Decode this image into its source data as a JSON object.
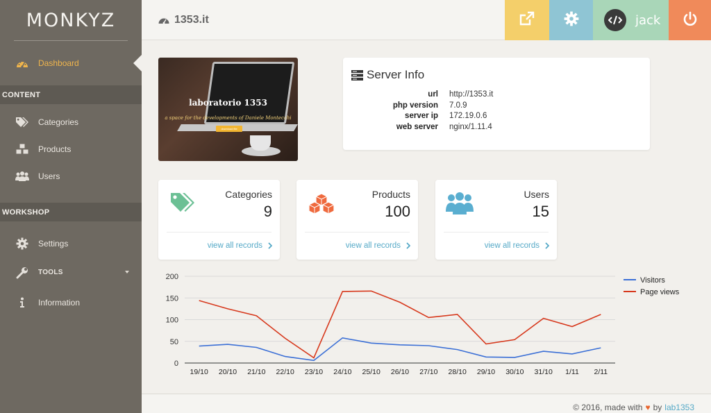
{
  "sidebar": {
    "logo": "MONKYZ",
    "items": {
      "dashboard": "Dashboard",
      "categories": "Categories",
      "products": "Products",
      "users": "Users",
      "settings": "Settings",
      "tools": "TOOLS",
      "information": "Information"
    },
    "sections": {
      "content": "CONTENT",
      "workshop": "WORKSHOP"
    }
  },
  "header": {
    "site": "1353.it",
    "user": "jack",
    "colors": {
      "external": "#f4cf6a",
      "settings": "#8fc5d4",
      "user": "#a9d6b8",
      "power": "#f08a5a"
    }
  },
  "hero": {
    "title": "laboratorio 1353",
    "subtitle": "a space for the developments of Daniele Montecchi",
    "button": "download file"
  },
  "server": {
    "title": "Server Info",
    "rows": [
      {
        "key": "url",
        "value": "http://1353.it"
      },
      {
        "key": "php version",
        "value": "7.0.9"
      },
      {
        "key": "server ip",
        "value": "172.19.0.6"
      },
      {
        "key": "web server",
        "value": "nginx/1.11.4"
      }
    ]
  },
  "stats": [
    {
      "label": "Categories",
      "value": "9",
      "link": "view all records",
      "icon": "tags-icon",
      "color": "#6cc095"
    },
    {
      "label": "Products",
      "value": "100",
      "link": "view all records",
      "icon": "cubes-icon",
      "color": "#ef6a3e"
    },
    {
      "label": "Users",
      "value": "15",
      "link": "view all records",
      "icon": "users-icon",
      "color": "#5aaed0"
    }
  ],
  "chart_data": {
    "type": "line",
    "categories": [
      "19/10",
      "20/10",
      "21/10",
      "22/10",
      "23/10",
      "24/10",
      "25/10",
      "26/10",
      "27/10",
      "28/10",
      "29/10",
      "30/10",
      "31/10",
      "1/11",
      "2/11"
    ],
    "series": [
      {
        "name": "Visitors",
        "color": "#3b6fd6",
        "values": [
          39,
          43,
          36,
          15,
          6,
          58,
          46,
          42,
          40,
          31,
          14,
          13,
          27,
          21,
          35
        ]
      },
      {
        "name": "Page views",
        "color": "#d7381c",
        "values": [
          144,
          125,
          109,
          57,
          12,
          165,
          166,
          140,
          105,
          112,
          44,
          54,
          103,
          84,
          112
        ]
      }
    ],
    "yticks": [
      0,
      50,
      100,
      150,
      200
    ],
    "ylim": [
      0,
      200
    ],
    "grid": true,
    "legend": "top-right"
  },
  "footer": {
    "text": "© 2016, made with",
    "by": "by",
    "link": "lab1353"
  }
}
